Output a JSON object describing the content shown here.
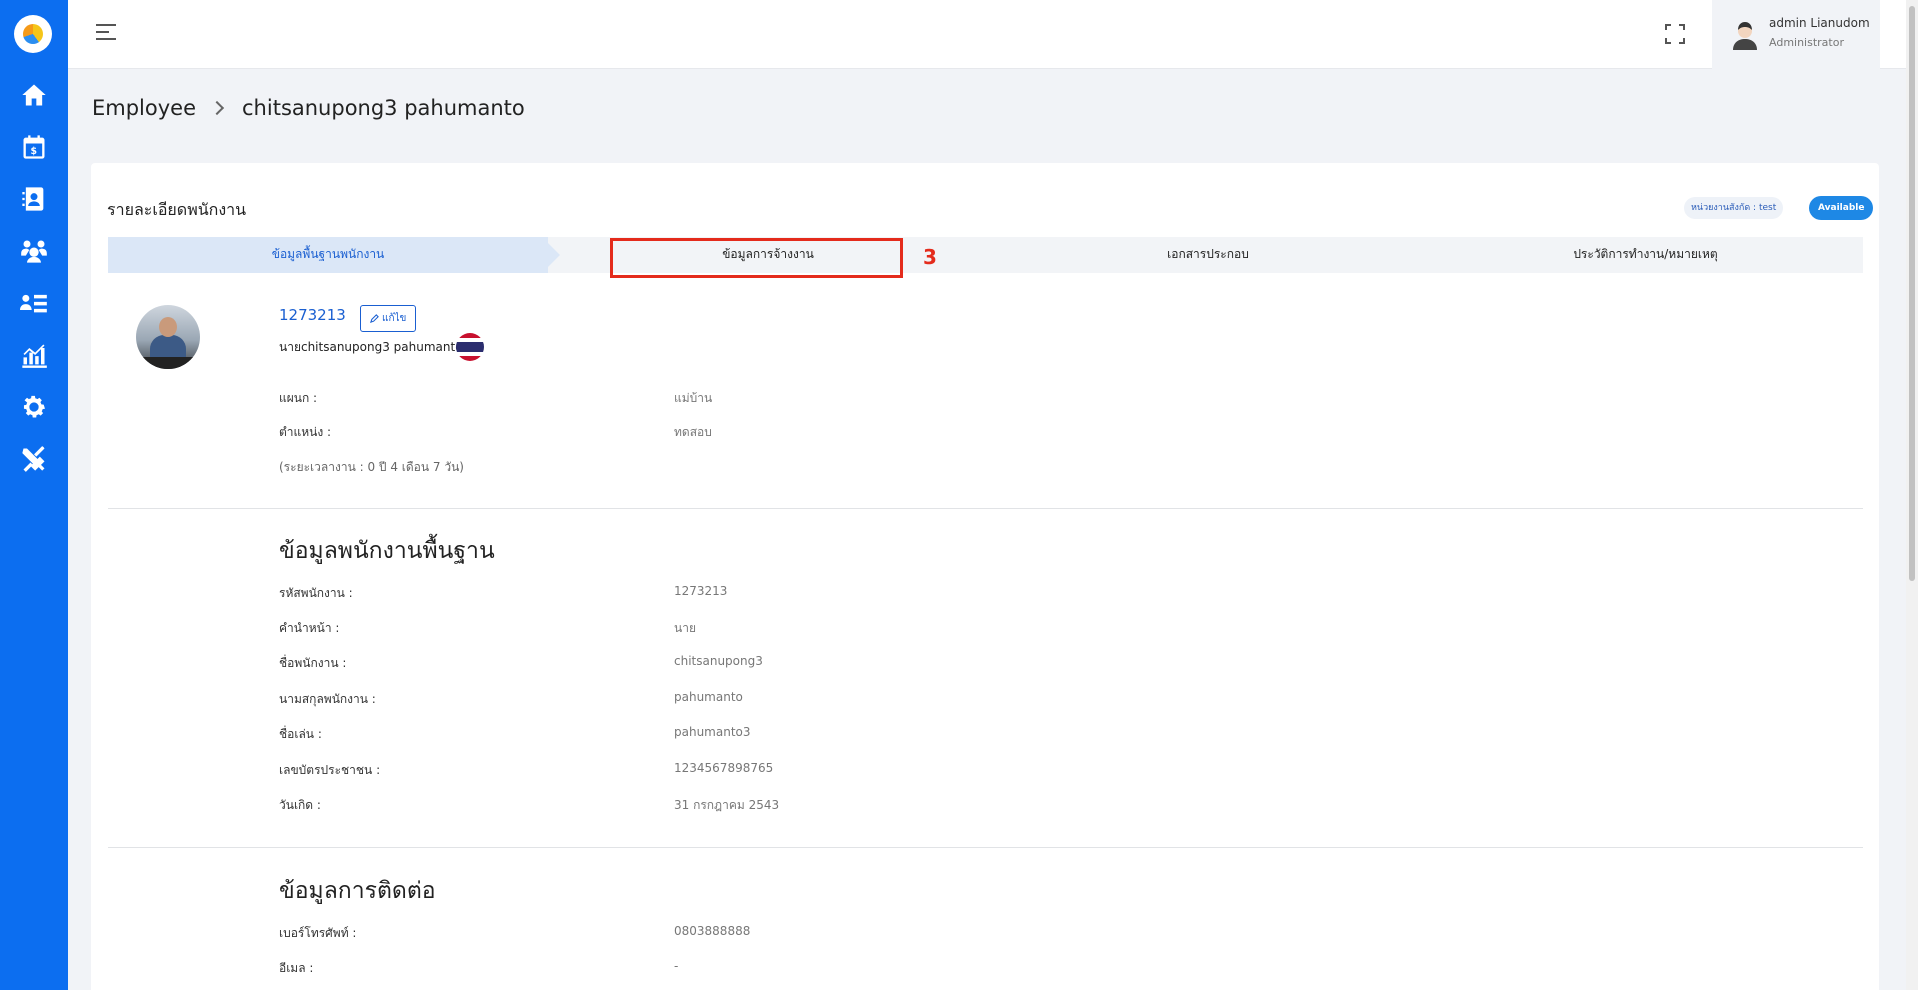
{
  "header": {
    "user_name": "admin Lianudom",
    "user_role": "Administrator"
  },
  "sidebar": {
    "items": [
      {
        "icon": "home-icon"
      },
      {
        "icon": "payroll-calendar-icon"
      },
      {
        "icon": "employee-contact-icon"
      },
      {
        "icon": "team-settings-icon"
      },
      {
        "icon": "user-list-icon"
      },
      {
        "icon": "report-chart-icon"
      },
      {
        "icon": "settings-gear-icon"
      },
      {
        "icon": "tools-icon"
      }
    ]
  },
  "breadcrumb": {
    "parent": "Employee",
    "current": "chitsanupong3 pahumanto"
  },
  "card": {
    "title": "รายละเอียดพนักงาน",
    "unit_badge": "หน่วยงานสังกัด : test",
    "status_badge": "Available"
  },
  "tabs": [
    {
      "label": "ข้อมูลพื้นฐานพนักงาน"
    },
    {
      "label": "ข้อมูลการจ้างงาน"
    },
    {
      "label": "เอกสารประกอบ"
    },
    {
      "label": "ประวัติการทำงาน/หมายเหตุ"
    }
  ],
  "annotation": {
    "step": "3"
  },
  "profile": {
    "code": "1273213",
    "edit_label": "แก้ไข",
    "full_name": "นายchitsanupong3 pahumanto",
    "department_label": "แผนก :",
    "department_value": "แม่บ้าน",
    "position_label": "ตำแหน่ง :",
    "position_value": "ทดสอบ",
    "tenure": "(ระยะเวลางาน : 0 ปี 4 เดือน 7 วัน)"
  },
  "basic_info": {
    "title": "ข้อมูลพนักงานพื้นฐาน",
    "rows": [
      {
        "label": "รหัสพนักงาน :",
        "value": "1273213"
      },
      {
        "label": "คำนำหน้า :",
        "value": "นาย"
      },
      {
        "label": "ชื่อพนักงาน :",
        "value": "chitsanupong3"
      },
      {
        "label": "นามสกุลพนักงาน :",
        "value": "pahumanto"
      },
      {
        "label": "ชื่อเล่น :",
        "value": "pahumanto3"
      },
      {
        "label": "เลขบัตรประชาชน :",
        "value": "1234567898765"
      },
      {
        "label": "วันเกิด :",
        "value": "31 กรกฎาคม 2543"
      }
    ]
  },
  "contact_info": {
    "title": "ข้อมูลการติดต่อ",
    "rows": [
      {
        "label": "เบอร์โทรศัพท์ :",
        "value": "0803888888"
      },
      {
        "label": "อีเมล :",
        "value": "-"
      }
    ]
  },
  "colors": {
    "sidebar": "#0c6ef0",
    "accent": "#1a5fd1",
    "highlight": "#e42b1c"
  }
}
